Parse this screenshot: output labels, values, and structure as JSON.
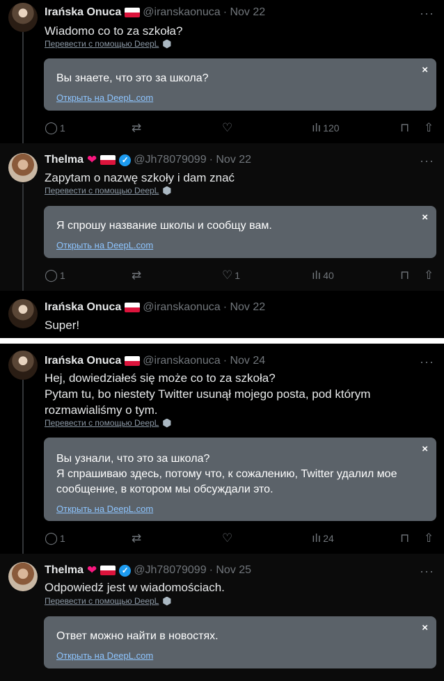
{
  "users": {
    "iranska": {
      "name": "Irańska Onuca",
      "handle": "@iranskaonuca"
    },
    "thelma": {
      "name": "Thelma",
      "handle": "@Jh78079099"
    }
  },
  "deepl": {
    "translate_label": "Перевести с помощью DeepL",
    "open_label": "Открыть на DeepL.com",
    "close_glyph": "×"
  },
  "icons": {
    "reply": "💬",
    "retweet": "⇄",
    "like": "♡",
    "views": "ılı",
    "bookmark": "⊓",
    "share": "⇧",
    "more": "···",
    "verified": "✓",
    "heart": "❤"
  },
  "tweets": [
    {
      "time": "· Nov 22",
      "text": "Wiadomo co to za szkoła?",
      "translation": "Вы знаете, что это за школа?",
      "replies": "1",
      "retweets": "",
      "likes": "",
      "views": "120"
    },
    {
      "time": "· Nov 22",
      "text": "Zapytam o nazwę szkoły i dam znać",
      "translation": "Я спрошу название школы и сообщу вам.",
      "replies": "1",
      "retweets": "",
      "likes": "1",
      "views": "40"
    },
    {
      "time": "· Nov 22",
      "text": "Super!"
    },
    {
      "time": "· Nov 24",
      "text": "Hej, dowiedziałeś się może co to za szkoła?\nPytam tu, bo niestety Twitter usunął mojego posta, pod którym rozmawialiśmy o tym.",
      "translation": "Вы узнали, что это за школа?\n Я спрашиваю здесь, потому что, к сожалению, Twitter удалил мое сообщение, в котором мы обсуждали это.",
      "replies": "1",
      "retweets": "",
      "likes": "",
      "views": "24"
    },
    {
      "time": "· Nov 25",
      "text": "Odpowiedź jest w wiadomościach.",
      "translation": "Ответ можно найти в новостях."
    }
  ]
}
